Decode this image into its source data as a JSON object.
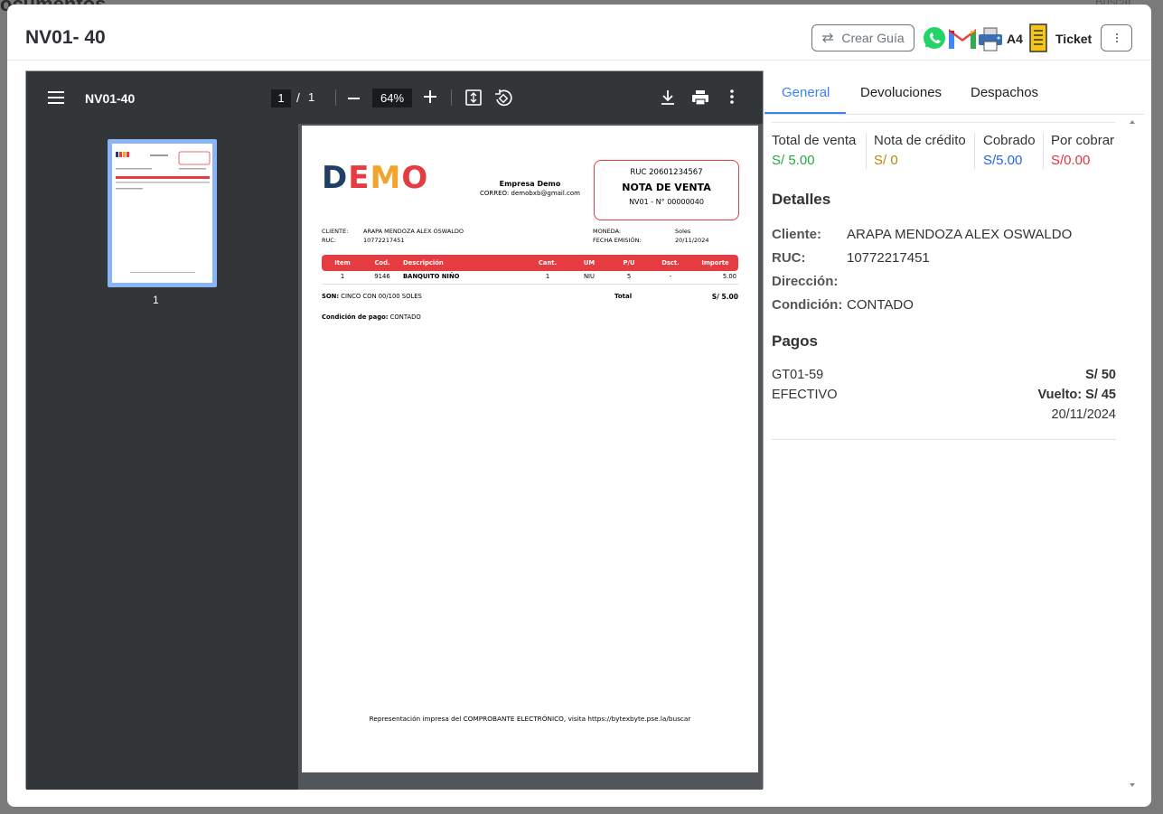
{
  "modal": {
    "title": "NV01- 40",
    "actions": {
      "crear_guia": "Crear Guía",
      "a4": "A4",
      "ticket": "Ticket"
    }
  },
  "viewer": {
    "file_name": "NV01-40",
    "page_current": "1",
    "page_sep": "/",
    "page_total": "1",
    "zoom": "64%",
    "thumb_label": "1"
  },
  "document": {
    "logo": [
      "D",
      "E",
      "M",
      "O"
    ],
    "logo_colors": [
      "#1f3f66",
      "#e43c40",
      "#f0a52e",
      "#e43c40"
    ],
    "empresa": "Empresa Demo",
    "correo": "CORREO: demobxb@gmail.com",
    "ruc": "RUC 20601234567",
    "doc_type": "NOTA DE VENTA",
    "doc_number": "NV01 - N° 00000040",
    "cliente_label": "CLIENTE:",
    "cliente": "ARAPA MENDOZA ALEX OSWALDO",
    "ruc_label": "RUC:",
    "ruc_cliente": "10772217451",
    "moneda_label": "MONEDA:",
    "moneda": "Soles",
    "fecha_label": "FECHA EMISIÓN:",
    "fecha": "20/11/2024",
    "table_headers": [
      "Item",
      "Cod.",
      "Descripción",
      "Cant.",
      "UM",
      "P/U",
      "Dsct.",
      "Importe"
    ],
    "table_rows": [
      [
        "1",
        "9146",
        "BANQUITO NIÑO",
        "1",
        "NIU",
        "5",
        "-",
        "5.00"
      ]
    ],
    "son_label": "SON:",
    "son": "CINCO CON 00/100 SOLES",
    "total_label": "Total",
    "total": "S/ 5.00",
    "condicion_label": "Condición de pago:",
    "condicion": "CONTADO",
    "footer": "Representación impresa del COMPROBANTE ELECTRÓNICO, visita https://bytexbyte.pse.la/buscar"
  },
  "tabs": [
    "General",
    "Devoluciones",
    "Despachos"
  ],
  "summary": [
    {
      "label": "Total de venta",
      "value": "S/ 5.00",
      "color": "#28a745"
    },
    {
      "label": "Nota de crédito",
      "value": "S/ 0",
      "color": "#b8860b"
    },
    {
      "label": "Cobrado",
      "value": "S/5.00",
      "color": "#2563eb"
    },
    {
      "label": "Por cobrar",
      "value": "S/0.00",
      "color": "#dc3545"
    }
  ],
  "detalles": {
    "title": "Detalles",
    "cliente_label": "Cliente:",
    "cliente": "ARAPA MENDOZA ALEX OSWALDO",
    "ruc_label": "RUC:",
    "ruc": "10772217451",
    "direccion_label": "Dirección:",
    "direccion": "",
    "condicion_label": "Condición:",
    "condicion": "CONTADO"
  },
  "pagos": {
    "title": "Pagos",
    "serie": "GT01-59",
    "monto": "S/ 50",
    "metodo": "EFECTIVO",
    "vuelto": "Vuelto: S/ 45",
    "fecha": "20/11/2024"
  },
  "background": {
    "title": "ocumentos",
    "search": "Buscar"
  }
}
